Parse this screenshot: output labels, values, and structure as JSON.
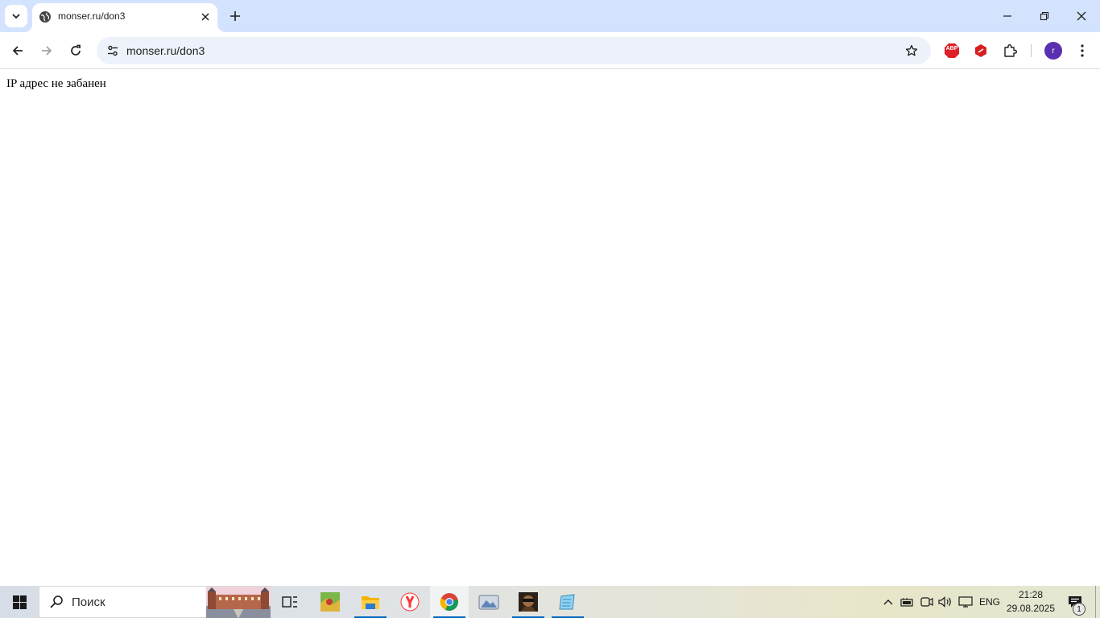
{
  "browser": {
    "tab": {
      "title": "monser.ru/don3"
    },
    "address_bar": {
      "url": "monser.ru/don3"
    },
    "extensions": {
      "abp_label": "ABP"
    },
    "profile": {
      "initial": "r"
    }
  },
  "page": {
    "text": "IP адрес не забанен"
  },
  "taskbar": {
    "search_placeholder": "Поиск",
    "language": "ENG",
    "time": "21:28",
    "date": "29.08.2025",
    "notification_count": "1"
  },
  "colors": {
    "tabstrip_bg": "#d3e3fd",
    "omnibox_bg": "#edf2fa",
    "avatar_bg": "#5a2fb0",
    "abp_red": "#e0202a",
    "running_indicator": "#0067c0"
  }
}
